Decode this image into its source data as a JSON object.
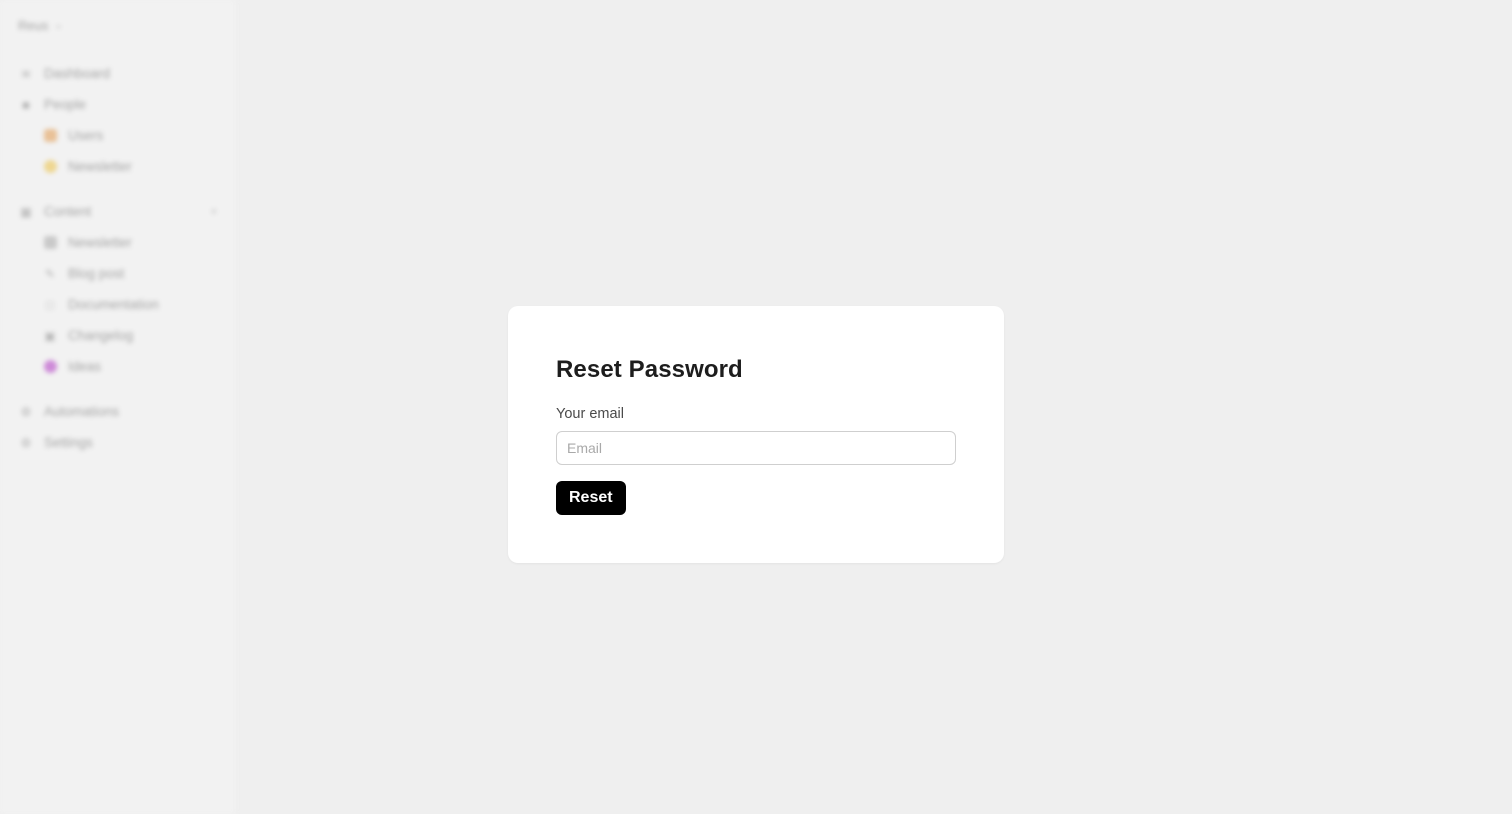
{
  "sidebar": {
    "workspace": "Reus",
    "items": [
      {
        "label": "Dashboard",
        "icon": "chart-icon"
      },
      {
        "label": "People",
        "icon": "person-icon"
      },
      {
        "label": "Users",
        "icon": "users-emoji-icon"
      },
      {
        "label": "Newsletter",
        "icon": "newsletter-emoji-icon"
      },
      {
        "label": "Content",
        "icon": "folder-icon"
      },
      {
        "label": "Newsletter",
        "icon": "newspaper-icon"
      },
      {
        "label": "Blog post",
        "icon": "pen-icon"
      },
      {
        "label": "Documentation",
        "icon": "document-icon"
      },
      {
        "label": "Changelog",
        "icon": "calendar-icon"
      },
      {
        "label": "Ideas",
        "icon": "bulb-icon"
      },
      {
        "label": "Automations",
        "icon": "bolt-icon"
      },
      {
        "label": "Settings",
        "icon": "gear-icon"
      }
    ]
  },
  "card": {
    "title": "Reset Password",
    "email_label": "Your email",
    "email_placeholder": "Email",
    "email_value": "",
    "reset_label": "Reset"
  },
  "colors": {
    "background": "#efefef",
    "card": "#ffffff",
    "button": "#000000",
    "button_text": "#ffffff"
  }
}
